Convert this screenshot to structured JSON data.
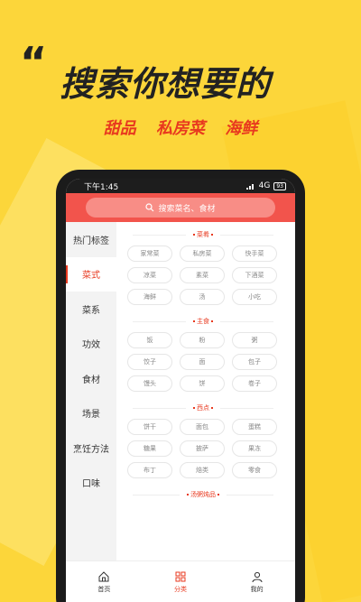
{
  "promo": {
    "quote_mark": "“",
    "headline": "搜索你想要的",
    "tags": [
      "甜品",
      "私房菜",
      "海鲜"
    ]
  },
  "status_bar": {
    "time": "下午1:45",
    "network": "4G",
    "battery": "93"
  },
  "search": {
    "placeholder": "搜索菜名、食材"
  },
  "sidebar": {
    "items": [
      "热门标签",
      "菜式",
      "菜系",
      "功效",
      "食材",
      "场景",
      "烹饪方法",
      "口味"
    ],
    "active_index": 1
  },
  "sections": [
    {
      "title": "菜肴",
      "tags": [
        "家常菜",
        "私房菜",
        "快手菜",
        "凉菜",
        "素菜",
        "下酒菜",
        "海鲜",
        "汤",
        "小吃"
      ]
    },
    {
      "title": "主食",
      "tags": [
        "饭",
        "粉",
        "粥",
        "饺子",
        "面",
        "包子",
        "馒头",
        "饼",
        "卷子"
      ]
    },
    {
      "title": "西点",
      "tags": [
        "饼干",
        "面包",
        "蛋糕",
        "糖果",
        "披萨",
        "果冻",
        "布丁",
        "焙类",
        "零食"
      ]
    },
    {
      "title": "汤粥炖品",
      "tags": []
    }
  ],
  "tabbar": {
    "items": [
      {
        "label": "首页",
        "icon": "home-icon"
      },
      {
        "label": "分类",
        "icon": "category-icon"
      },
      {
        "label": "我的",
        "icon": "profile-icon"
      }
    ],
    "active_index": 1
  },
  "colors": {
    "background": "#fcd63a",
    "accent": "#f2544c",
    "accent_text": "#e8391f"
  }
}
